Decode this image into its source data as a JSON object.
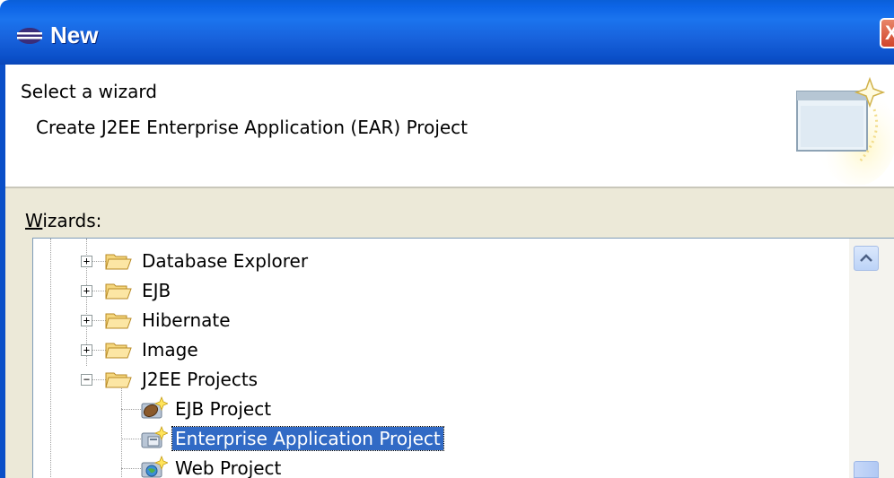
{
  "window": {
    "title": "New",
    "close_symbol": "X"
  },
  "header": {
    "title": "Select a wizard",
    "description": "Create J2EE Enterprise Application (EAR) Project",
    "art_icon": "wizard-banner-icon"
  },
  "wizards": {
    "label_accel": "W",
    "label_rest": "izards:",
    "tree": [
      {
        "label": "Database Explorer",
        "type": "folder",
        "expanded": false
      },
      {
        "label": "EJB",
        "type": "folder",
        "expanded": false
      },
      {
        "label": "Hibernate",
        "type": "folder",
        "expanded": false
      },
      {
        "label": "Image",
        "type": "folder",
        "expanded": false
      },
      {
        "label": "J2EE Projects",
        "type": "folder",
        "expanded": true
      },
      {
        "label": "EJB Project",
        "type": "item",
        "icon": "ejb-project-icon"
      },
      {
        "label": "Enterprise Application Project",
        "type": "item",
        "icon": "enterprise-app-project-icon",
        "selected": true
      },
      {
        "label": "Web Project",
        "type": "item",
        "icon": "web-project-icon"
      }
    ],
    "expander_collapsed": "+",
    "expander_expanded": "−"
  },
  "colors": {
    "titlebar": "#0c64e6",
    "selection": "#316ac5",
    "dialog_bg": "#ece9d8"
  }
}
